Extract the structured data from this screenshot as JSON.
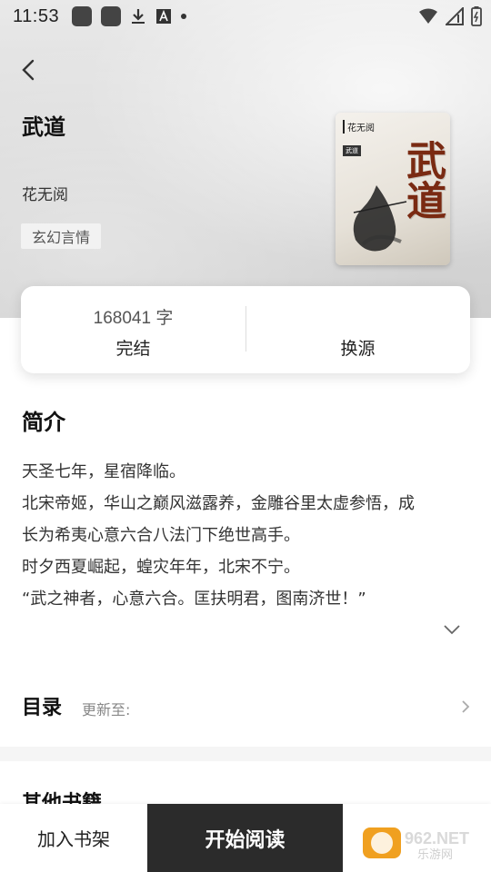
{
  "status_bar": {
    "time": "11:53"
  },
  "book": {
    "title": "武道",
    "author": "花无阅",
    "genre": "玄幻言情",
    "cover": {
      "author_text": "花无阅",
      "small_tag": "武道",
      "title_text": "武道"
    }
  },
  "stats": {
    "word_count": "168041 字",
    "status": "完结",
    "source_label": "换源"
  },
  "intro": {
    "title": "简介",
    "lines": [
      "天圣七年，星宿降临。",
      "北宋帝姬，华山之巅风滋露养，金雕谷里太虚参悟，成",
      "长为希夷心意六合八法门下绝世高手。",
      "时夕西夏崛起，蝗灾年年，北宋不宁。",
      "“武之神者，心意六合。匡扶明君，图南济世！”"
    ]
  },
  "toc": {
    "title": "目录",
    "update_label": "更新至:"
  },
  "other_books": {
    "title": "其他书籍"
  },
  "bottom_bar": {
    "add_shelf": "加入书架",
    "start_reading": "开始阅读"
  },
  "watermark": {
    "text_top": "962.NET",
    "text_bottom": "乐游网"
  },
  "colors": {
    "primary_dark": "#2b2b2b",
    "cover_title": "#7a2a12"
  },
  "icons": [
    "chevron-left-icon",
    "chevron-down-icon",
    "chevron-right-icon",
    "wifi-icon",
    "signal-icon",
    "battery-icon",
    "download-icon"
  ]
}
